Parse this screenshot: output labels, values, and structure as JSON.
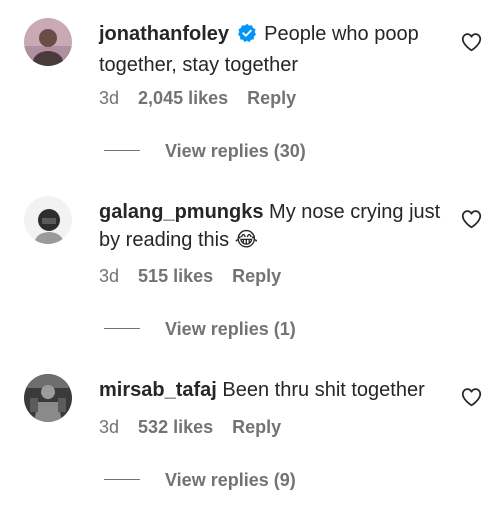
{
  "comments": [
    {
      "username": "jonathanfoley",
      "verified": true,
      "text": "People who poop together, stay together",
      "time": "3d",
      "likes": "2,045 likes",
      "reply_label": "Reply",
      "view_replies": "View replies (30)"
    },
    {
      "username": "galang_pmungks",
      "verified": false,
      "text": "My nose crying just by reading this 😂",
      "time": "3d",
      "likes": "515 likes",
      "reply_label": "Reply",
      "view_replies": "View replies (1)"
    },
    {
      "username": "mirsab_tafaj",
      "verified": false,
      "text": "Been thru shit together",
      "time": "3d",
      "likes": "532 likes",
      "reply_label": "Reply",
      "view_replies": "View replies (9)"
    }
  ],
  "icons": {
    "like": "heart-outline-icon",
    "verified": "verified-badge-icon"
  },
  "colors": {
    "text": "#262626",
    "secondary": "#737373",
    "verified": "#0095f6"
  }
}
